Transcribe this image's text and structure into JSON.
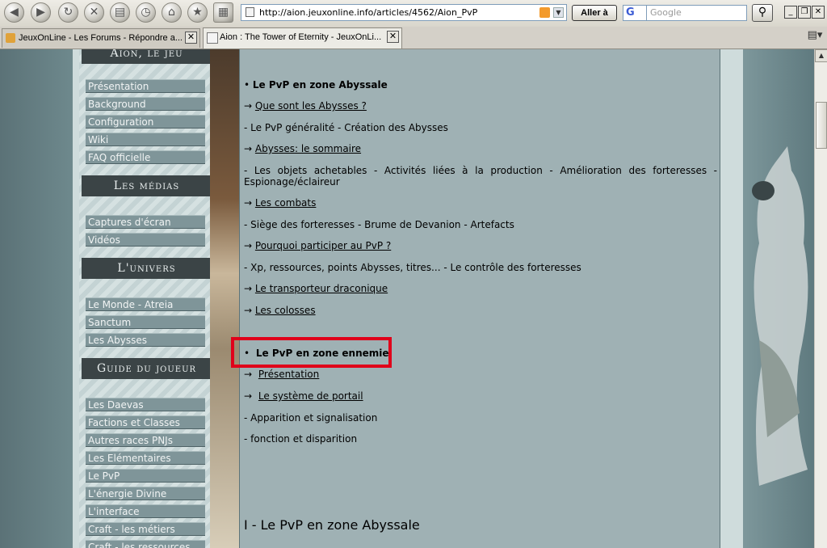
{
  "browser": {
    "url": "http://aion.jeuxonline.info/articles/4562/Aion_PvP",
    "go_label": "Aller à",
    "search_engine": "G",
    "search_placeholder": "Google",
    "nav_icons": [
      "back-icon",
      "forward-icon",
      "reload-icon",
      "stop-icon",
      "print-icon",
      "history-icon",
      "home-icon",
      "bookmark-star-icon",
      "page-icon"
    ],
    "tabs": [
      {
        "label": "JeuxOnLine - Les Forums - Répondre a..."
      },
      {
        "label": "Aion : The Tower of Eternity - JeuxOnLi..."
      }
    ]
  },
  "sidebar": {
    "top_head": "Aion, le jeu",
    "top_items": [
      "Présentation",
      "Background",
      "Configuration",
      "Wiki",
      "FAQ officielle"
    ],
    "medias_head": "Les médias",
    "medias_items": [
      "Captures d'écran",
      "Vidéos"
    ],
    "univers_head": "L'univers",
    "univers_items": [
      "Le Monde - Atreia",
      "Sanctum",
      "Les Abysses"
    ],
    "guide_head": "Guide du joueur",
    "guide_items": [
      "Les Daevas",
      "Factions et Classes",
      "Autres races PNJs",
      "Les Elémentaires",
      "Le PvP",
      "L'énergie Divine",
      "L'interface",
      "Craft - les métiers",
      "Craft - les ressources"
    ]
  },
  "content": {
    "sec1_title": "Le PvP en zone Abyssale",
    "link_abysses": "Que sont les Abysses ?",
    "desc1": "- Le PvP généralité - Création des Abysses",
    "link_sommaire": "Abysses: le sommaire",
    "desc2": "- Les objets achetables - Activités liées à la production - Amélioration des forteresses - Espionage/éclaireur",
    "link_combats": "Les combats",
    "desc3": "- Siège des forteresses - Brume de Devanion - Artefacts",
    "link_pourquoi": "Pourquoi participer au PvP ?",
    "desc4": "- Xp, ressources, points Abysses, titres... - Le contrôle des forteresses",
    "link_transporteur": "Le transporteur draconique",
    "link_colosses": "Les colosses",
    "sec2_title": "Le PvP en zone ennemie",
    "link_presentation": "Présentation",
    "link_portail": "Le système de portail",
    "desc5": "- Apparition et signalisation",
    "desc6": "- fonction et disparition",
    "heading": "I - Le PvP en zone Abyssale",
    "arrow": "→",
    "bullet": "•"
  }
}
